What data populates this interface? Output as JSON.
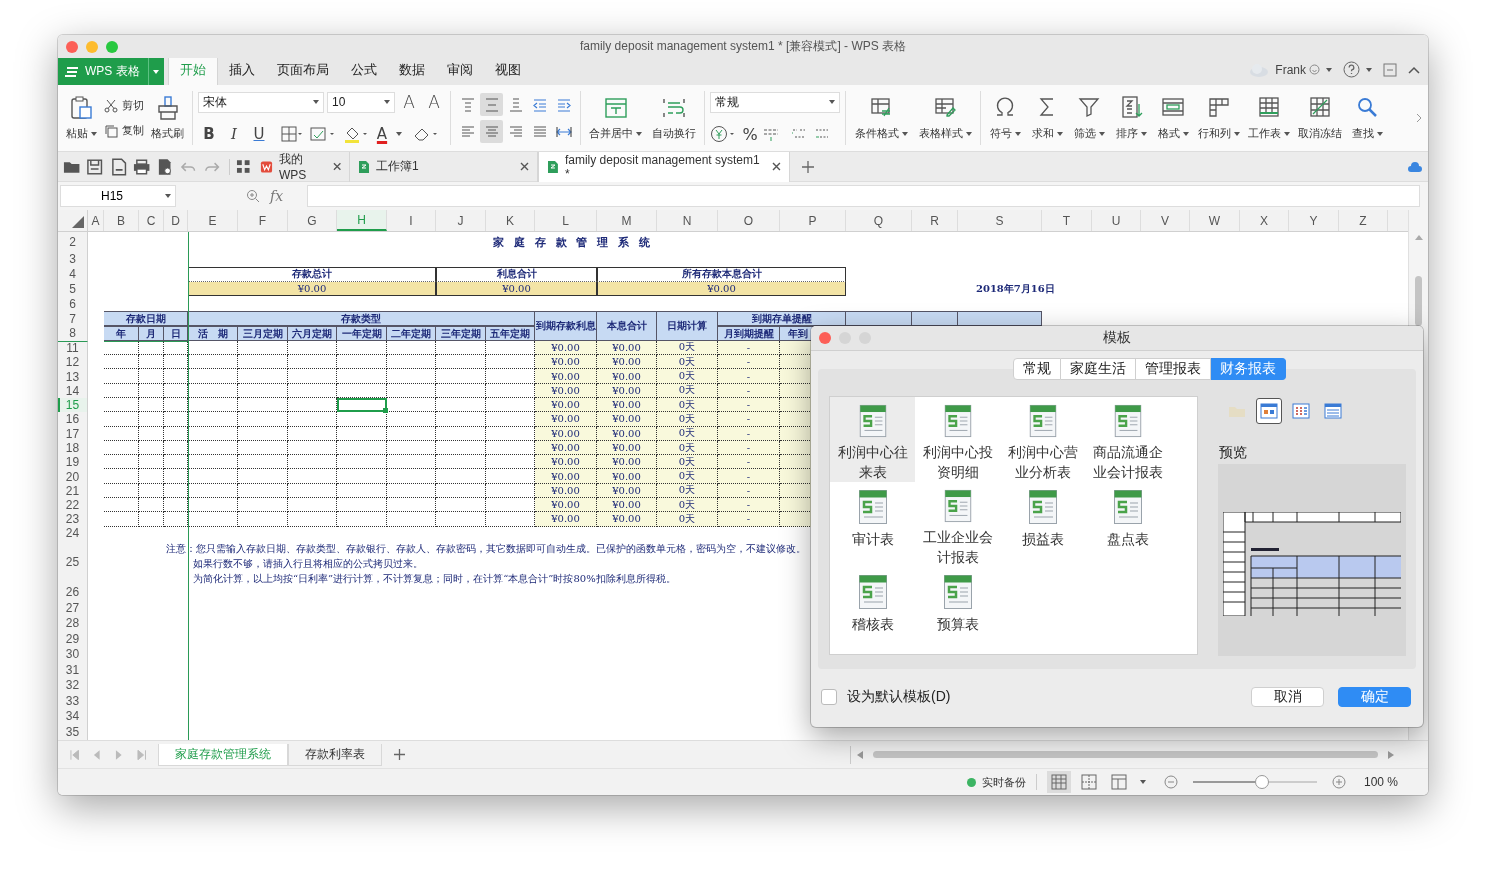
{
  "window": {
    "title": "family deposit management system1 * [兼容模式] - WPS 表格"
  },
  "app_menu": {
    "label": "WPS 表格"
  },
  "menu_tabs": [
    {
      "label": "开始",
      "selected": true
    },
    {
      "label": "插入",
      "selected": false
    },
    {
      "label": "页面布局",
      "selected": false
    },
    {
      "label": "公式",
      "selected": false
    },
    {
      "label": "数据",
      "selected": false
    },
    {
      "label": "审阅",
      "selected": false
    },
    {
      "label": "视图",
      "selected": false
    }
  ],
  "account": {
    "user": "Frank"
  },
  "ribbon": {
    "paste": {
      "label": "粘贴",
      "dropdown": true
    },
    "clipboard": [
      {
        "label": "剪切"
      },
      {
        "label": "复制"
      }
    ],
    "format_painter": {
      "label": "格式刷"
    },
    "font": {
      "name": "宋体",
      "size": "10",
      "size_buttons": [
        "A",
        "A"
      ],
      "styles": [
        "B",
        "I",
        "U"
      ],
      "color_glyph": "A"
    },
    "alignment": [
      {
        "selected": false
      },
      {
        "selected": true
      },
      {
        "selected": false
      },
      {
        "selected": false
      },
      {
        "selected": false
      },
      {
        "selected": false
      },
      {
        "selected": true
      },
      {
        "selected": false
      },
      {
        "selected": false
      },
      {
        "selected": false
      }
    ],
    "merge": {
      "label": "合并居中",
      "dropdown": true
    },
    "wrap": {
      "label": "自动换行",
      "dropdown": false
    },
    "number_format": "常规",
    "percent": "%",
    "style_tools": [
      {
        "label": "条件格式",
        "dropdown": true
      },
      {
        "label": "表格样式",
        "dropdown": true
      }
    ],
    "tools": [
      {
        "label": "符号",
        "dropdown": true
      },
      {
        "label": "求和",
        "dropdown": true
      },
      {
        "label": "筛选",
        "dropdown": true
      },
      {
        "label": "排序",
        "dropdown": true
      },
      {
        "label": "格式",
        "dropdown": true
      },
      {
        "label": "行和列",
        "dropdown": true
      },
      {
        "label": "工作表",
        "dropdown": true
      },
      {
        "label": "取消冻结",
        "dropdown": false
      },
      {
        "label": "查找",
        "dropdown": true
      }
    ]
  },
  "doc_tabs": [
    {
      "label": "我的WPS",
      "kind": "home",
      "selected": false
    },
    {
      "label": "工作簿1",
      "kind": "sheet",
      "selected": false
    },
    {
      "label": "family deposit management system1 *",
      "kind": "sheet",
      "selected": true
    }
  ],
  "formula_bar": {
    "cell": "H15",
    "fx": "fx"
  },
  "sheet": {
    "columns": [
      {
        "letter": "A",
        "selected": false
      },
      {
        "letter": "B",
        "selected": false
      },
      {
        "letter": "C",
        "selected": false
      },
      {
        "letter": "D",
        "selected": false
      },
      {
        "letter": "E",
        "selected": false
      },
      {
        "letter": "F",
        "selected": false
      },
      {
        "letter": "G",
        "selected": false
      },
      {
        "letter": "H",
        "selected": true
      },
      {
        "letter": "I",
        "selected": false
      },
      {
        "letter": "J",
        "selected": false
      },
      {
        "letter": "K",
        "selected": false
      },
      {
        "letter": "L",
        "selected": false
      },
      {
        "letter": "M",
        "selected": false
      },
      {
        "letter": "N",
        "selected": false
      },
      {
        "letter": "O",
        "selected": false
      },
      {
        "letter": "P",
        "selected": false
      },
      {
        "letter": "Q",
        "selected": false
      },
      {
        "letter": "R",
        "selected": false
      },
      {
        "letter": "S",
        "selected": false
      },
      {
        "letter": "T",
        "selected": false
      },
      {
        "letter": "U",
        "selected": false
      },
      {
        "letter": "V",
        "selected": false
      },
      {
        "letter": "W",
        "selected": false
      },
      {
        "letter": "X",
        "selected": false
      },
      {
        "letter": "Y",
        "selected": false
      },
      {
        "letter": "Z",
        "selected": false
      }
    ],
    "rows": [
      {
        "label": "2",
        "selected": false
      },
      {
        "label": "3",
        "selected": false
      },
      {
        "label": "4",
        "selected": false
      },
      {
        "label": "5",
        "selected": false
      },
      {
        "label": "6",
        "selected": false
      },
      {
        "label": "7",
        "selected": false
      },
      {
        "label": "8",
        "selected": false
      },
      {
        "label": "11",
        "selected": false
      },
      {
        "label": "12",
        "selected": false
      },
      {
        "label": "13",
        "selected": false
      },
      {
        "label": "14",
        "selected": false
      },
      {
        "label": "15",
        "selected": true
      },
      {
        "label": "16",
        "selected": false
      },
      {
        "label": "17",
        "selected": false
      },
      {
        "label": "18",
        "selected": false
      },
      {
        "label": "19",
        "selected": false
      },
      {
        "label": "20",
        "selected": false
      },
      {
        "label": "21",
        "selected": false
      },
      {
        "label": "22",
        "selected": false
      },
      {
        "label": "23",
        "selected": false
      },
      {
        "label": "24",
        "selected": false
      },
      {
        "label": "25",
        "selected": false
      },
      {
        "label": "26",
        "selected": false
      },
      {
        "label": "27",
        "selected": false
      },
      {
        "label": "28",
        "selected": false
      },
      {
        "label": "29",
        "selected": false
      },
      {
        "label": "30",
        "selected": false
      },
      {
        "label": "31",
        "selected": false
      },
      {
        "label": "32",
        "selected": false
      },
      {
        "label": "33",
        "selected": false
      },
      {
        "label": "34",
        "selected": false
      },
      {
        "label": "35",
        "selected": false
      }
    ],
    "title": "家 庭 存 款 管 理 系 统",
    "summary": [
      {
        "label": "存款总计",
        "value": "¥0.00"
      },
      {
        "label": "利息合计",
        "value": "¥0.00"
      },
      {
        "label": "所有存款本息合计",
        "value": "¥0.00"
      }
    ],
    "date": "2018年7月16日",
    "headers": [
      {
        "label": "存款日期",
        "sub": [
          "年",
          "月",
          "日"
        ]
      },
      {
        "label": "存款类型",
        "sub": [
          "活　期",
          "三月定期",
          "六月定期",
          "一年定期",
          "二年定期",
          "三年定期",
          "五年定期"
        ]
      },
      {
        "label": "到期存款利息"
      },
      {
        "label": "本息合计"
      },
      {
        "label": "日期计算"
      },
      {
        "label": "到期存单提醒",
        "sub": [
          "月到期提醒",
          "年到"
        ]
      }
    ],
    "table_rows": [
      {
        "interest": "¥0.00",
        "total": "¥0.00",
        "days": "0天",
        "reminder": "-"
      },
      {
        "interest": "¥0.00",
        "total": "¥0.00",
        "days": "0天",
        "reminder": "-"
      },
      {
        "interest": "¥0.00",
        "total": "¥0.00",
        "days": "0天",
        "reminder": "-"
      },
      {
        "interest": "¥0.00",
        "total": "¥0.00",
        "days": "0天",
        "reminder": "-"
      },
      {
        "interest": "¥0.00",
        "total": "¥0.00",
        "days": "0天",
        "reminder": "-"
      },
      {
        "interest": "¥0.00",
        "total": "¥0.00",
        "days": "0天",
        "reminder": "-"
      },
      {
        "interest": "¥0.00",
        "total": "¥0.00",
        "days": "0天",
        "reminder": "-"
      },
      {
        "interest": "¥0.00",
        "total": "¥0.00",
        "days": "0天",
        "reminder": "-"
      },
      {
        "interest": "¥0.00",
        "total": "¥0.00",
        "days": "0天",
        "reminder": "-"
      },
      {
        "interest": "¥0.00",
        "total": "¥0.00",
        "days": "0天",
        "reminder": "-"
      },
      {
        "interest": "¥0.00",
        "total": "¥0.00",
        "days": "0天",
        "reminder": "-"
      },
      {
        "interest": "¥0.00",
        "total": "¥0.00",
        "days": "0天",
        "reminder": "-"
      },
      {
        "interest": "¥0.00",
        "total": "¥0.00",
        "days": "0天",
        "reminder": "-"
      }
    ],
    "notes": [
      "注意：您只需输入存款日期、存款类型、存款银行、存款人、存款密码，其它数据即可自动生成。已保护的函数单元格，密码为空，不建议修改。",
      "如果行数不够，请插入行且将相应的公式拷贝过来。",
      "为简化计算，以上均按“日利率”进行计算，不计算复息；同时，在计算“本息合计”时按80%扣除利息所得税。"
    ]
  },
  "sheet_tabs": [
    {
      "label": "家庭存款管理系统",
      "selected": true
    },
    {
      "label": "存款利率表",
      "selected": false
    }
  ],
  "status_bar": {
    "backup": "实时备份",
    "views": [
      {
        "selected": true
      },
      {
        "selected": false
      },
      {
        "selected": false
      }
    ],
    "zoom": {
      "level": 0.5,
      "reading": "100 %"
    }
  },
  "dialog": {
    "title": "模板",
    "tabs": [
      {
        "label": "常规",
        "selected": false
      },
      {
        "label": "家庭生活",
        "selected": false
      },
      {
        "label": "管理报表",
        "selected": false
      },
      {
        "label": "财务报表",
        "selected": true
      }
    ],
    "templates": [
      {
        "label": "利润中心往来表",
        "selected": true
      },
      {
        "label": "利润中心投资明细",
        "selected": false
      },
      {
        "label": "利润中心营业分析表",
        "selected": false
      },
      {
        "label": "商品流通企业会计报表",
        "selected": false
      },
      {
        "label": "审计表",
        "selected": false
      },
      {
        "label": "工业企业会计报表",
        "selected": false
      },
      {
        "label": "损益表",
        "selected": false
      },
      {
        "label": "盘点表",
        "selected": false
      },
      {
        "label": "稽核表",
        "selected": false
      },
      {
        "label": "预算表",
        "selected": false
      }
    ],
    "view_buttons": [
      {
        "selected": false,
        "disabled": true
      },
      {
        "selected": true,
        "disabled": false
      },
      {
        "selected": false,
        "disabled": false
      },
      {
        "selected": false,
        "disabled": false
      }
    ],
    "preview_label": "预览",
    "default_template": {
      "label": "设为默认模板(D)",
      "checked": false
    },
    "buttons": [
      {
        "label": "取消",
        "kind": "secondary"
      },
      {
        "label": "确定",
        "kind": "primary"
      }
    ]
  }
}
